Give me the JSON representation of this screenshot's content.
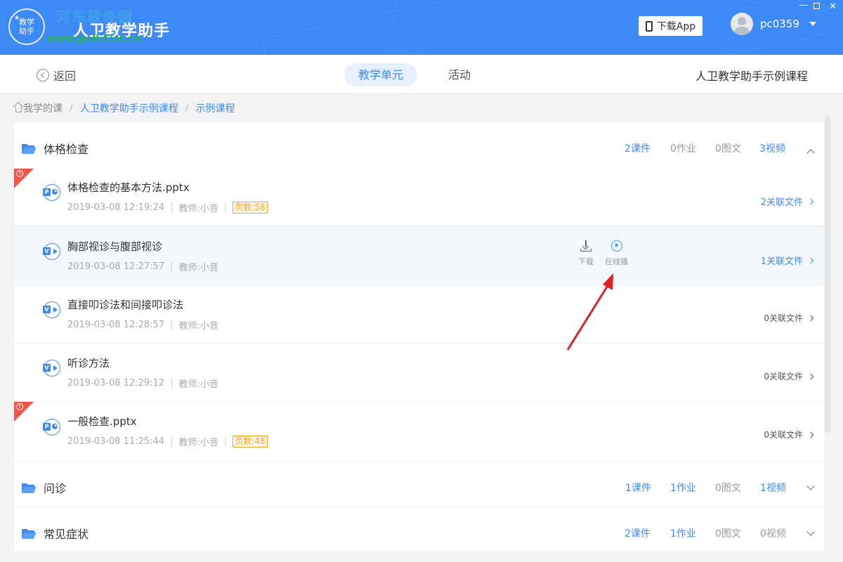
{
  "app": {
    "title": "人卫教学助手",
    "logo_text_line1": "教学",
    "logo_text_line2": "助手",
    "watermark_top": "河东软件园",
    "watermark_url": "www.pc0359.cn"
  },
  "header": {
    "download_app_label": "下载App",
    "username": "pc0359",
    "win_min": "—",
    "win_close": "✕"
  },
  "nav": {
    "back_label": "返回",
    "tabs": [
      {
        "label": "教学单元",
        "active": true
      },
      {
        "label": "活动",
        "active": false
      }
    ],
    "course_name": "人卫教学助手示例课程"
  },
  "breadcrumb": {
    "home": "我学的课",
    "items": [
      "人卫教学助手示例课程",
      "示例课程"
    ],
    "separator": "/"
  },
  "units": [
    {
      "title": "体格检查",
      "expanded": true,
      "stats": {
        "courseware": "2课件",
        "homework": "0作业",
        "graphic": "0图文",
        "video": "3视频"
      },
      "resources": [
        {
          "type": "ppt",
          "title": "体格检查的基本方法.pptx",
          "time": "2019-03-08 12:19:24",
          "teacher": "教师:小音",
          "pages": "页数:58",
          "related": "2关联文件",
          "flag": true
        },
        {
          "type": "video",
          "title": "胸部视诊与腹部视诊",
          "time": "2019-03-08 12:27:57",
          "teacher": "教师:小音",
          "related": "1关联文件",
          "highlighted": true,
          "actions": {
            "download": "下载",
            "play": "在线播"
          }
        },
        {
          "type": "video",
          "title": "直接叩诊法和间接叩诊法",
          "time": "2019-03-08 12:28:57",
          "teacher": "教师:小音",
          "related": "0关联文件"
        },
        {
          "type": "video",
          "title": "听诊方法",
          "time": "2019-03-08 12:29:12",
          "teacher": "教师:小音",
          "related": "0关联文件"
        },
        {
          "type": "ppt",
          "title": "一般检查.pptx",
          "time": "2019-03-08 11:25:44",
          "teacher": "教师:小音",
          "pages": "页数:48",
          "related": "0关联文件",
          "flag": true
        }
      ]
    },
    {
      "title": "问诊",
      "expanded": false,
      "stats": {
        "courseware": "1课件",
        "homework": "1作业",
        "graphic": "0图文",
        "video": "1视频"
      }
    },
    {
      "title": "常见症状",
      "expanded": false,
      "stats": {
        "courseware": "2课件",
        "homework": "1作业",
        "graphic": "0图文",
        "video": "0视频"
      }
    }
  ],
  "colors": {
    "primary": "#3d8af7",
    "flag_red": "#f0574a",
    "pages_orange": "#f5a623",
    "arrow_red": "#e02020"
  },
  "icons": {
    "ppt_badge": "P",
    "video_badge": "V"
  }
}
